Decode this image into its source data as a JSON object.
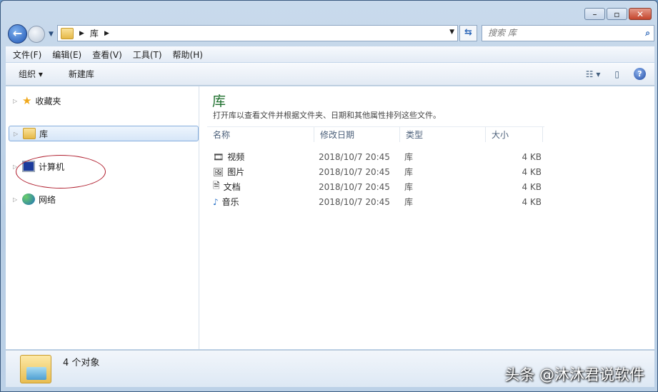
{
  "address": {
    "crumbs": [
      "库"
    ]
  },
  "search": {
    "placeholder": "搜索 库"
  },
  "menu": [
    "文件(F)",
    "编辑(E)",
    "查看(V)",
    "工具(T)",
    "帮助(H)"
  ],
  "toolbar": {
    "organize": "组织 ▾",
    "new_library": "新建库"
  },
  "tree": [
    {
      "label": "收藏夹",
      "icon": "star-icon"
    },
    {
      "label": "库",
      "icon": "library-icon",
      "selected": true
    },
    {
      "label": "计算机",
      "icon": "computer-icon"
    },
    {
      "label": "网络",
      "icon": "network-icon"
    }
  ],
  "content": {
    "title": "库",
    "subtitle": "打开库以查看文件并根据文件夹、日期和其他属性排列这些文件。",
    "columns": [
      "名称",
      "修改日期",
      "类型",
      "大小"
    ],
    "rows": [
      {
        "name": "视频",
        "date": "2018/10/7 20:45",
        "type": "库",
        "size": "4 KB",
        "icon": "video-icon"
      },
      {
        "name": "图片",
        "date": "2018/10/7 20:45",
        "type": "库",
        "size": "4 KB",
        "icon": "picture-icon"
      },
      {
        "name": "文档",
        "date": "2018/10/7 20:45",
        "type": "库",
        "size": "4 KB",
        "icon": "document-icon"
      },
      {
        "name": "音乐",
        "date": "2018/10/7 20:45",
        "type": "库",
        "size": "4 KB",
        "icon": "music-icon"
      }
    ]
  },
  "status": {
    "count": "4 个对象"
  },
  "watermark": "头条 @沐沐君说软件"
}
